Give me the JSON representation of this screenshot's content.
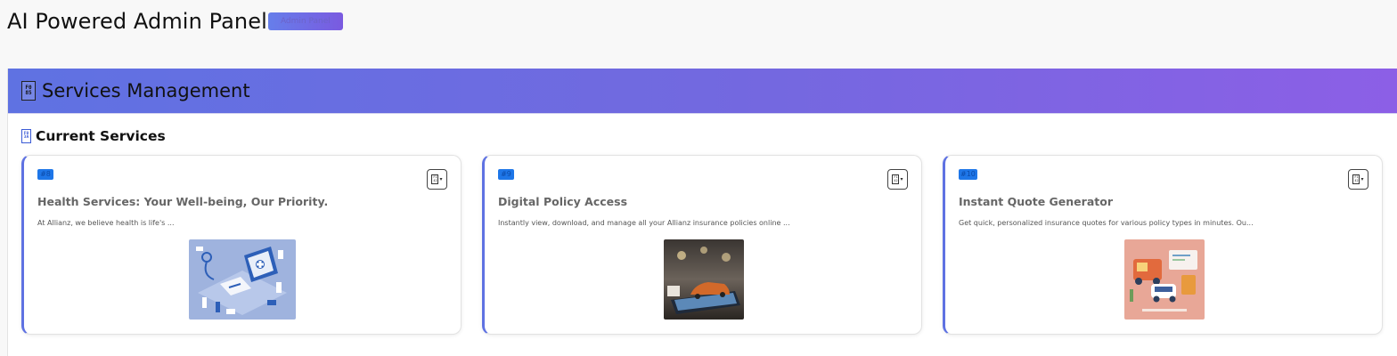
{
  "header": {
    "title": "AI Powered Admin Panel",
    "badge": "Admin Panel"
  },
  "panel": {
    "title": "Services Management",
    "title_icon": "services-glyph",
    "section_title": "Current Services",
    "section_icon": "list-glyph"
  },
  "services": [
    {
      "id": "#8",
      "title": "Health Services: Your Well-being, Our Priority.",
      "description": "At Allianz, we believe health is life's ...",
      "image": "health-isometric-illustration"
    },
    {
      "id": "#9",
      "title": "Digital Policy Access",
      "description": "Instantly view, download, and manage all your Allianz insurance policies online ...",
      "image": "car-on-tablet-photo"
    },
    {
      "id": "#10",
      "title": "Instant Quote Generator",
      "description": "Get quick, personalized insurance quotes for various policy types in minutes. Ou...",
      "image": "insurance-quote-illustration"
    }
  ],
  "colors": {
    "accent": "#5f72e2",
    "accent_end": "#8c5fe6",
    "id_badge": "#1e76e8"
  }
}
